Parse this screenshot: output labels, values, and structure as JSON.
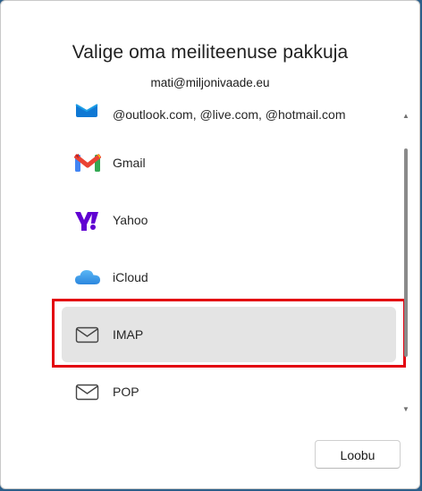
{
  "dialog": {
    "title": "Valige oma meiliteenuse pakkuja",
    "account_email": "mati@miljonivaade.eu",
    "cancel_label": "Loobu"
  },
  "providers": [
    {
      "id": "outlook",
      "label": "@outlook.com, @live.com, @hotmail.com",
      "icon": "outlook-icon",
      "selected": false
    },
    {
      "id": "gmail",
      "label": "Gmail",
      "icon": "gmail-icon",
      "selected": false
    },
    {
      "id": "yahoo",
      "label": "Yahoo",
      "icon": "yahoo-icon",
      "selected": false
    },
    {
      "id": "icloud",
      "label": "iCloud",
      "icon": "icloud-icon",
      "selected": false
    },
    {
      "id": "imap",
      "label": "IMAP",
      "icon": "envelope-icon",
      "selected": true
    },
    {
      "id": "pop",
      "label": "POP",
      "icon": "envelope-icon",
      "selected": false
    }
  ],
  "scrollbar": {
    "position": 0.35,
    "visible_fraction": 0.75
  },
  "colors": {
    "selected_background": "#e4e4e4",
    "highlight_border": "#e3000f",
    "outlook_blue": "#0f78d4",
    "yahoo_purple": "#6001d2",
    "icloud_blue": "#3a9bea"
  }
}
